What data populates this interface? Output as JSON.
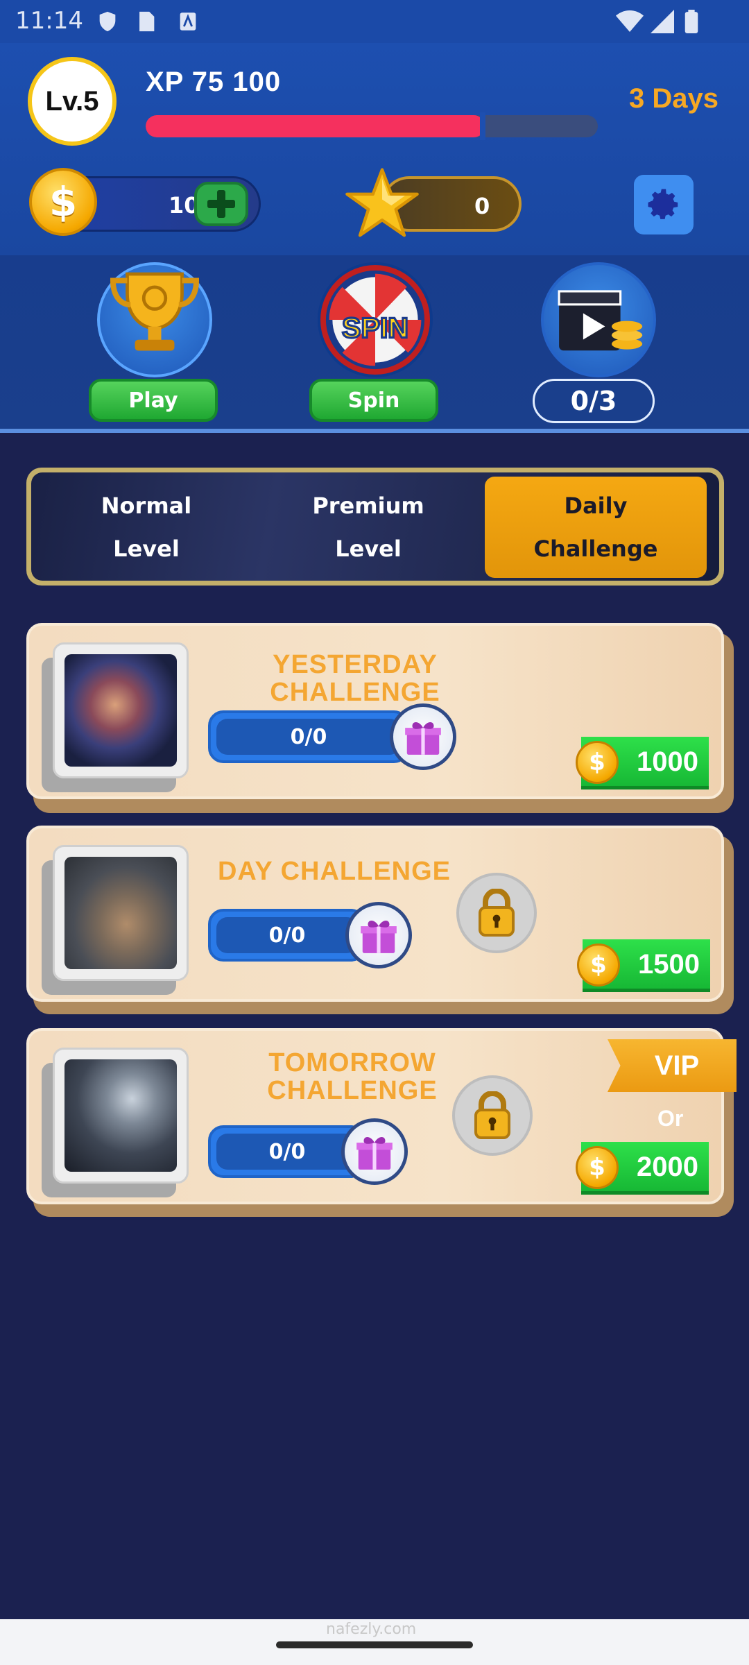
{
  "status_bar": {
    "time": "11:14"
  },
  "header": {
    "level_label": "Lv.5",
    "xp_label": "XP 75 100",
    "xp_progress": 0.75,
    "days_label": "3 Days",
    "coins": "100",
    "stars": "0"
  },
  "features": [
    {
      "button_label": "Play",
      "icon": "trophy-icon"
    },
    {
      "button_label": "Spin",
      "icon": "spin-wheel-icon",
      "art_text": "SPIN"
    },
    {
      "counter_label": "0/3",
      "icon": "video-reward-icon"
    }
  ],
  "tabs": [
    {
      "label": "Normal\nLevel",
      "active": false
    },
    {
      "label": "Premium\nLevel",
      "active": false
    },
    {
      "label": "Daily\nChallenge",
      "active": true
    }
  ],
  "challenges": [
    {
      "title": "YESTERDAY CHALLENGE",
      "progress": "0/0",
      "reward": "1000",
      "locked": false
    },
    {
      "title": "DAY CHALLENGE",
      "progress": "0/0",
      "reward": "1500",
      "locked": true
    },
    {
      "title": "TOMORROW\nCHALLENGE",
      "progress": "0/0",
      "reward": "2000",
      "locked": true,
      "vip_label": "VIP",
      "or_label": "Or"
    }
  ],
  "colors": {
    "header_bg": "#1d4fb0",
    "page_bg": "#1b2150",
    "accent_orange": "#f5a812",
    "xp_bar": "#f5305e",
    "reward_green": "#2ee04a"
  },
  "watermark": "nafezly.com"
}
